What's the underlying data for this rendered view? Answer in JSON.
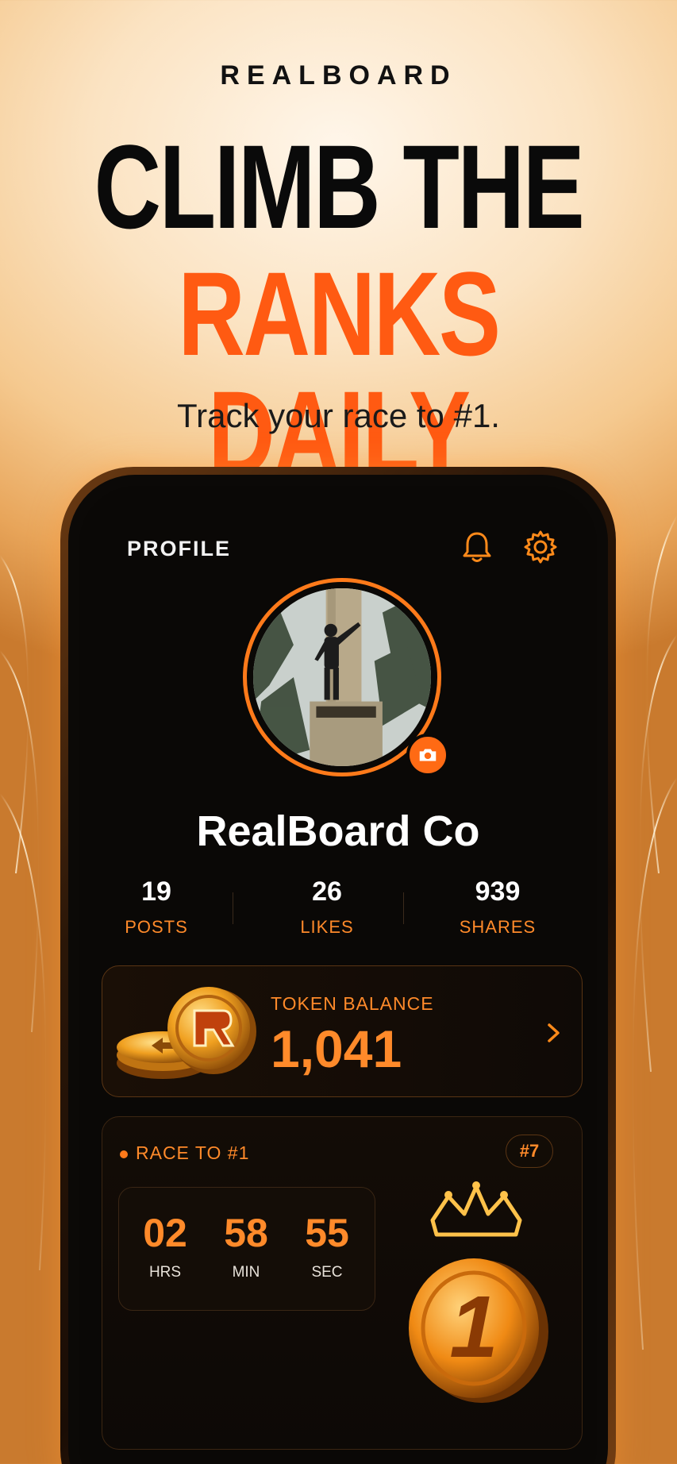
{
  "brand": "REALBOARD",
  "headline": {
    "line1": "CLIMB THE",
    "line2": "RANKS DAILY"
  },
  "subtitle": "Track your race to #1.",
  "profile": {
    "title": "PROFILE",
    "name": "RealBoard Co",
    "icons": {
      "notifications": "bell-icon",
      "settings": "gear-icon",
      "camera": "camera-icon"
    },
    "stats": [
      {
        "value": "19",
        "label": "POSTS"
      },
      {
        "value": "26",
        "label": "LIKES"
      },
      {
        "value": "939",
        "label": "SHARES"
      }
    ]
  },
  "token": {
    "label": "TOKEN BALANCE",
    "value": "1,041"
  },
  "race": {
    "label": "RACE TO #1",
    "rank": "#7",
    "timer": {
      "hours": "02",
      "hours_label": "HRS",
      "minutes": "58",
      "minutes_label": "MIN",
      "seconds": "55",
      "seconds_label": "SEC"
    },
    "badge_digit": "1"
  },
  "colors": {
    "accent": "#ff7a1a",
    "headline_accent": "#ff5a12",
    "screen_bg": "#0a0806"
  }
}
